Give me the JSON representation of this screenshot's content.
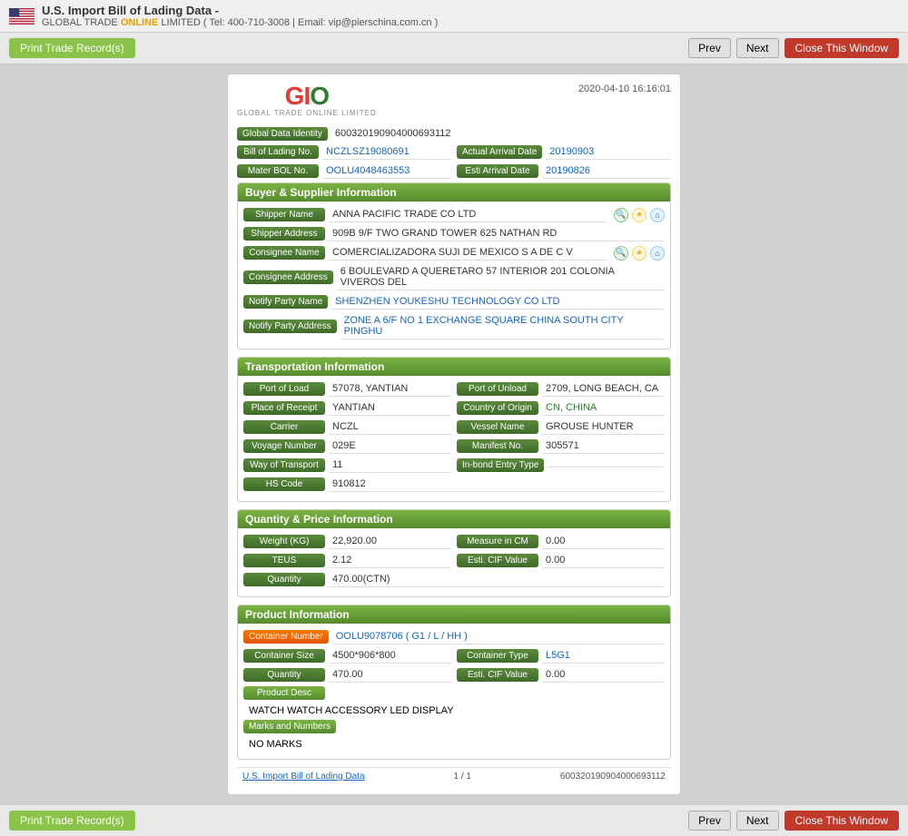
{
  "header": {
    "title": "U.S. Import Bill of Lading Data  -",
    "subtitle_prefix": "GLOBAL TRADE ",
    "subtitle_online": "ONLINE",
    "subtitle_suffix": " LIMITED ( Tel: 400-710-3008 | Email: vip@pierschina.com.cn )"
  },
  "toolbar": {
    "print_label": "Print Trade Record(s)",
    "prev_label": "Prev",
    "next_label": "Next",
    "close_label": "Close This Window"
  },
  "document": {
    "logo": "GIO",
    "logo_subtitle": "GLOBAL TRADE ONLINE LIMITED",
    "timestamp": "2020-04-10 16:16:01",
    "global_data_identity_label": "Global Data Identity",
    "global_data_identity_value": "600320190904000693112",
    "bill_of_lading_label": "Bill of Lading No.",
    "bill_of_lading_value": "NCZLSZ19080691",
    "actual_arrival_label": "Actual Arrival Date",
    "actual_arrival_value": "20190903",
    "mater_bol_label": "Mater BOL No.",
    "mater_bol_value": "OOLU4048463553",
    "esti_arrival_label": "Esti Arrival Date",
    "esti_arrival_value": "20190826"
  },
  "buyer_supplier": {
    "section_title": "Buyer & Supplier Information",
    "shipper_name_label": "Shipper Name",
    "shipper_name_value": "ANNA PACIFIC TRADE CO LTD",
    "shipper_address_label": "Shipper Address",
    "shipper_address_value": "909B 9/F TWO GRAND TOWER 625 NATHAN RD",
    "consignee_name_label": "Consignee Name",
    "consignee_name_value": "COMERCIALIZADORA SUJI DE MEXICO S A DE C V",
    "consignee_address_label": "Consignee Address",
    "consignee_address_value": "6 BOULEVARD A QUERETARO 57 INTERIOR 201 COLONIA VIVEROS DEL",
    "notify_party_label": "Notify Party Name",
    "notify_party_value": "SHENZHEN YOUKESHU TECHNOLOGY CO LTD",
    "notify_party_address_label": "Notify Party Address",
    "notify_party_address_value": "ZONE A 6/F NO 1 EXCHANGE SQUARE CHINA SOUTH CITY PINGHU"
  },
  "transportation": {
    "section_title": "Transportation Information",
    "port_of_load_label": "Port of Load",
    "port_of_load_value": "57078, YANTIAN",
    "port_of_unload_label": "Port of Unload",
    "port_of_unload_value": "2709, LONG BEACH, CA",
    "place_of_receipt_label": "Place of Receipt",
    "place_of_receipt_value": "YANTIAN",
    "country_of_origin_label": "Country of Origin",
    "country_of_origin_value": "CN, CHINA",
    "carrier_label": "Carrier",
    "carrier_value": "NCZL",
    "vessel_name_label": "Vessel Name",
    "vessel_name_value": "GROUSE HUNTER",
    "voyage_number_label": "Voyage Number",
    "voyage_number_value": "029E",
    "manifest_no_label": "Manifest No.",
    "manifest_no_value": "305571",
    "way_of_transport_label": "Way of Transport",
    "way_of_transport_value": "11",
    "in_bond_entry_label": "In-bond Entry Type",
    "in_bond_entry_value": "",
    "hs_code_label": "HS Code",
    "hs_code_value": "910812"
  },
  "quantity_price": {
    "section_title": "Quantity & Price Information",
    "weight_label": "Weight (KG)",
    "weight_value": "22,920.00",
    "measure_cm_label": "Measure in CM",
    "measure_cm_value": "0.00",
    "teus_label": "TEUS",
    "teus_value": "2.12",
    "esti_cif_label": "Esti. CIF Value",
    "esti_cif_value": "0.00",
    "quantity_label": "Quantity",
    "quantity_value": "470.00(CTN)"
  },
  "product_info": {
    "section_title": "Product Information",
    "container_number_label": "Container Number",
    "container_number_value": "OOLU9078706 ( G1 / L / HH )",
    "container_size_label": "Container Size",
    "container_size_value": "4500*906*800",
    "container_type_label": "Container Type",
    "container_type_value": "L5G1",
    "quantity_label": "Quantity",
    "quantity_value": "470.00",
    "esti_cif_label": "Esti. CIF Value",
    "esti_cif_value": "0.00",
    "product_desc_label": "Product Desc",
    "product_desc_value": "WATCH WATCH ACCESSORY LED DISPLAY",
    "marks_numbers_label": "Marks and Numbers",
    "marks_numbers_value": "NO MARKS"
  },
  "footer": {
    "left_text": "U.S. Import Bill of Lading Data",
    "page_info": "1 / 1",
    "right_text": "600320190904000693112"
  },
  "bottom_toolbar": {
    "print_label": "Print Trade Record(s)",
    "prev_label": "Prev",
    "next_label": "Next",
    "close_label": "Close This Window"
  }
}
